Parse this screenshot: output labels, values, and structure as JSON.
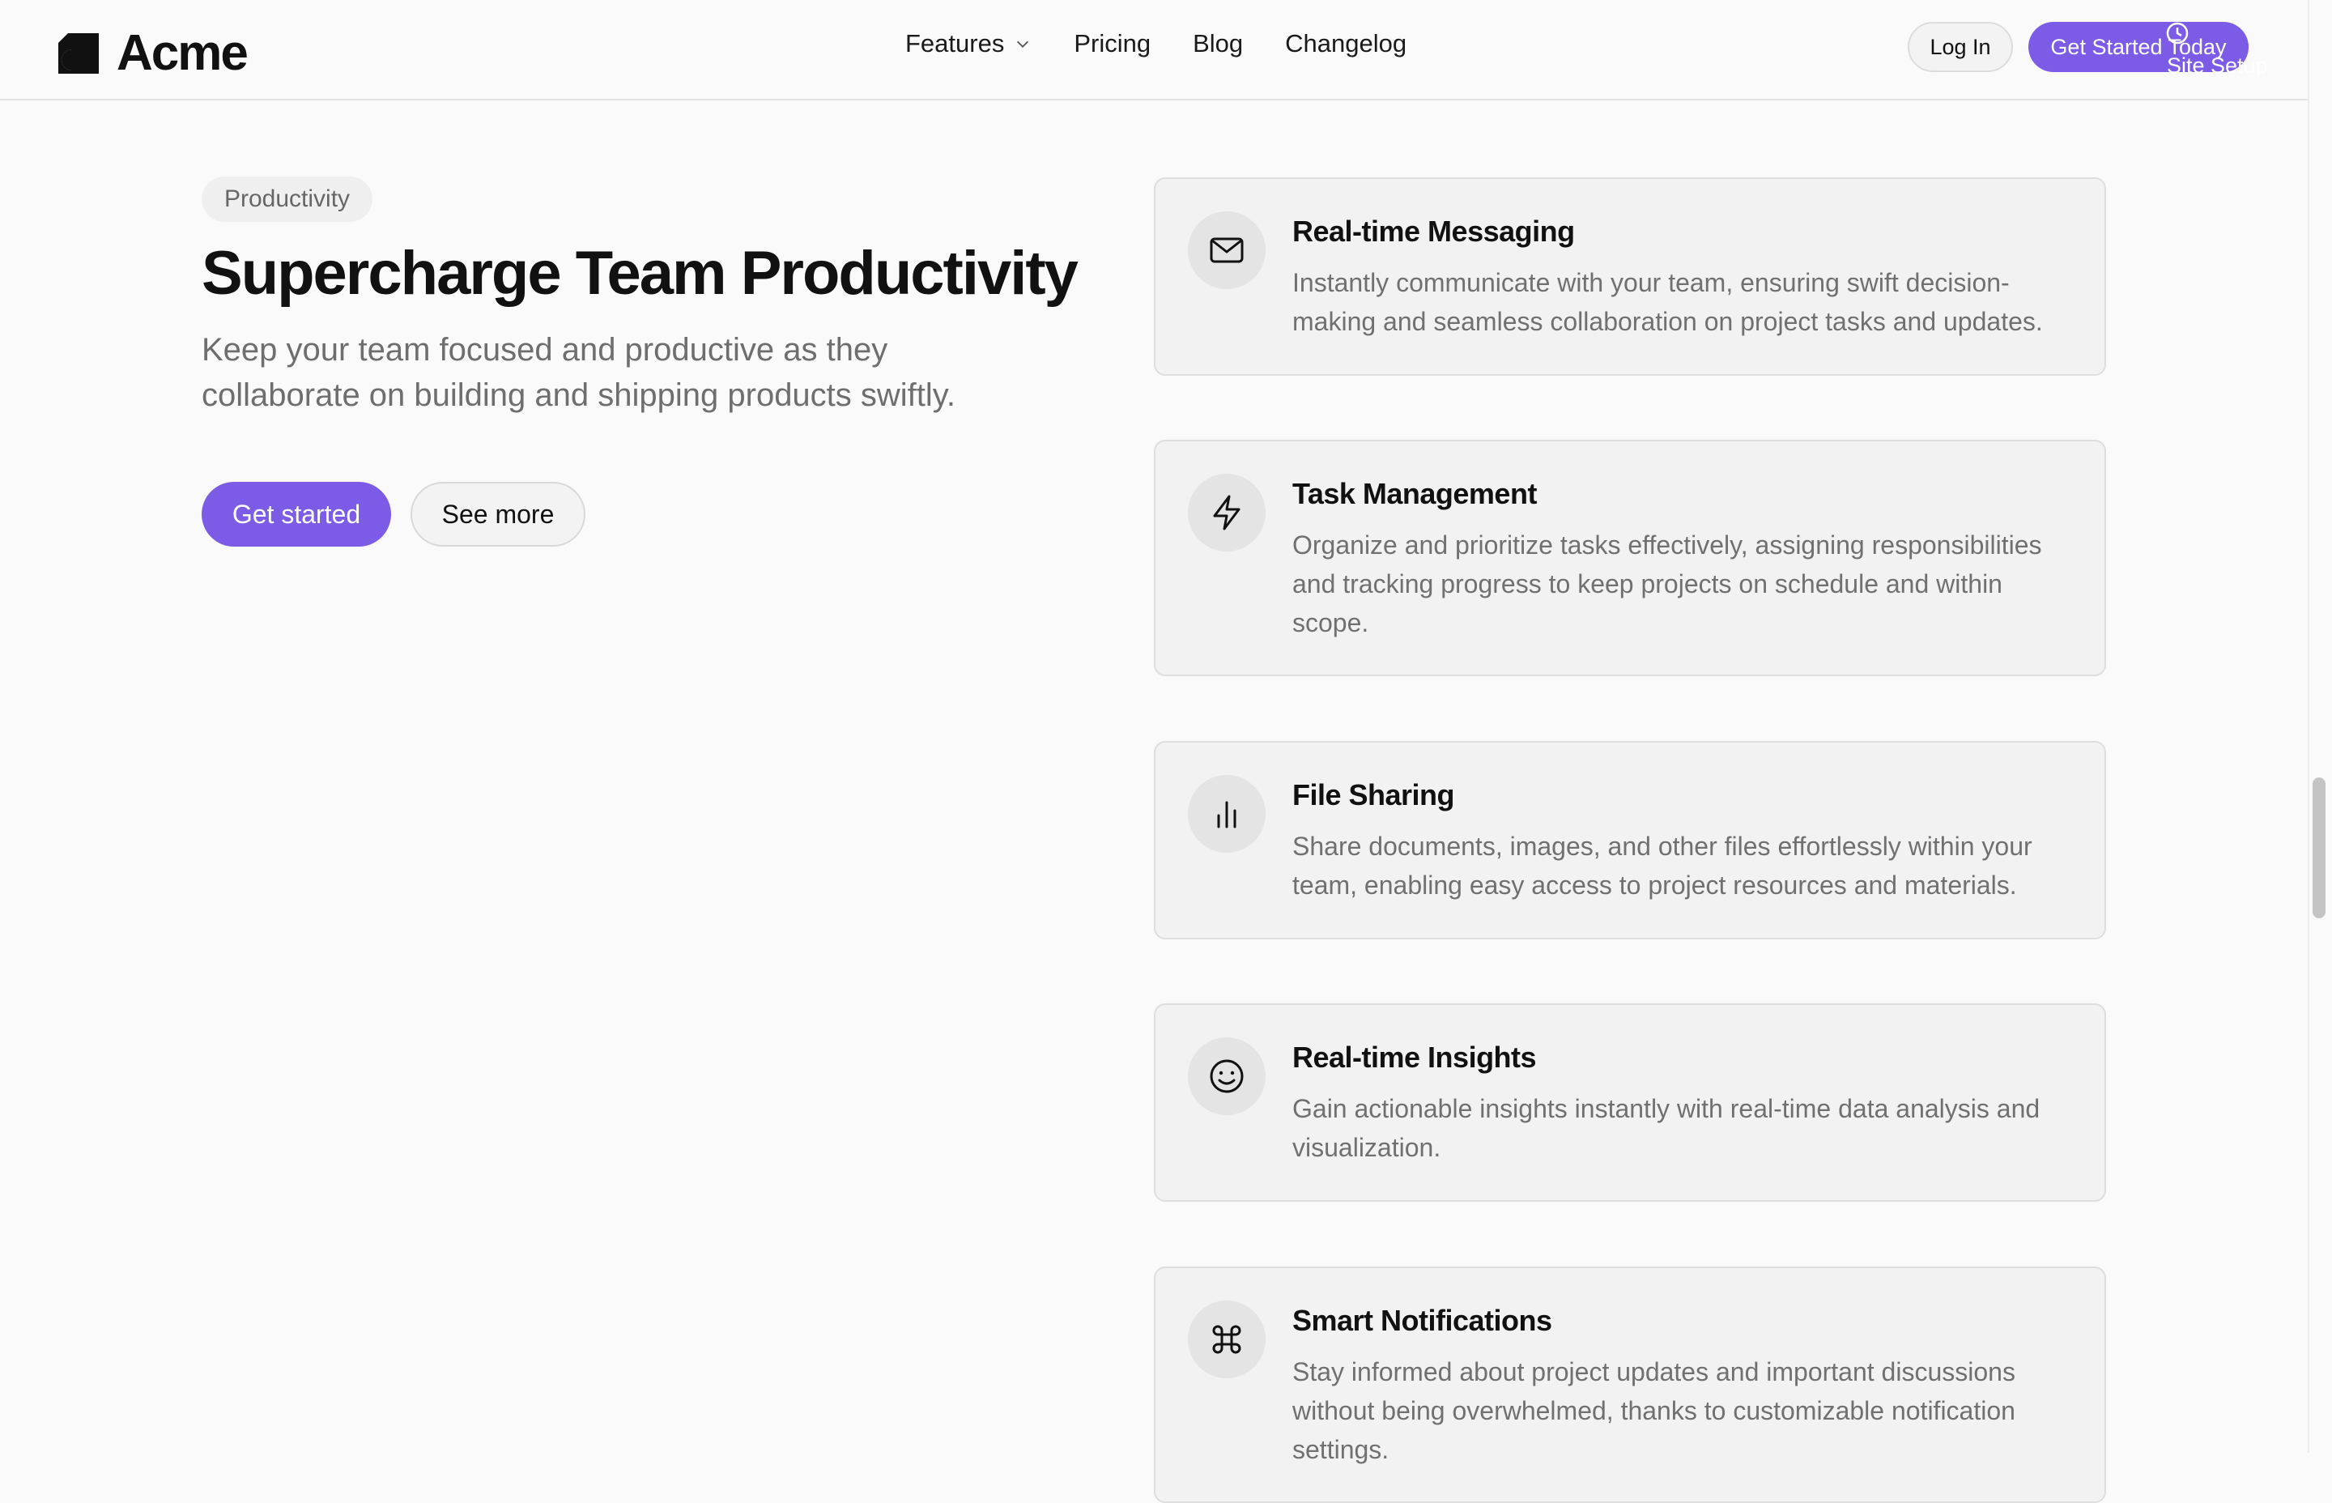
{
  "header": {
    "logo_text": "Acme",
    "nav": [
      {
        "label": "Features"
      },
      {
        "label": "Pricing"
      },
      {
        "label": "Blog"
      },
      {
        "label": "Changelog"
      }
    ],
    "login_label": "Log In",
    "cta_label": "Get Started Today",
    "overlay_label": "Site Setup"
  },
  "hero": {
    "badge": "Productivity",
    "title": "Supercharge Team Productivity",
    "subtitle": "Keep your team focused and productive as they collaborate on building and shipping products swiftly.",
    "primary_button": "Get started",
    "secondary_button": "See more"
  },
  "features": [
    {
      "icon": "mail-icon",
      "title": "Real-time Messaging",
      "description": "Instantly communicate with your team, ensuring swift decision-making and seamless collaboration on project tasks and updates."
    },
    {
      "icon": "lightning-icon",
      "title": "Task Management",
      "description": "Organize and prioritize tasks effectively, assigning responsibilities and tracking progress to keep projects on schedule and within scope."
    },
    {
      "icon": "bar-chart-icon",
      "title": "File Sharing",
      "description": "Share documents, images, and other files effortlessly within your team, enabling easy access to project resources and materials."
    },
    {
      "icon": "smile-icon",
      "title": "Real-time Insights",
      "description": "Gain actionable insights instantly with real-time data analysis and visualization."
    },
    {
      "icon": "command-icon",
      "title": "Smart Notifications",
      "description": "Stay informed about project updates and important discussions without being overwhelmed, thanks to customizable notification settings."
    }
  ],
  "colors": {
    "accent": "#7c5ce6",
    "background": "#fafafa",
    "card_background": "#f2f2f2"
  }
}
